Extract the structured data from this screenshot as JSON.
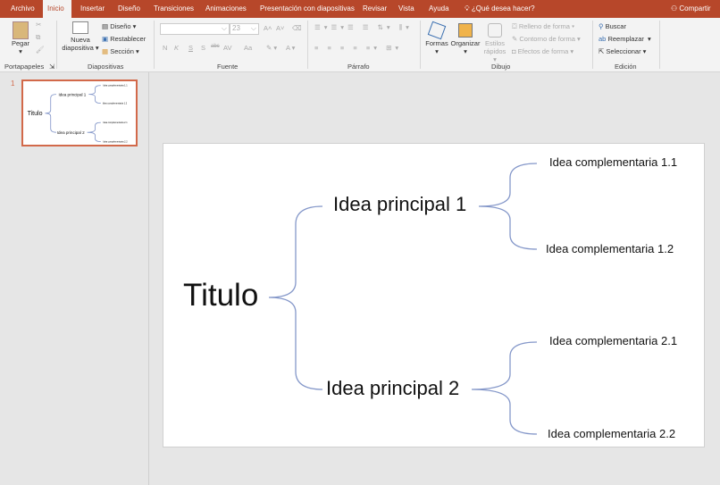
{
  "tabs": [
    "Archivo",
    "Inicio",
    "Insertar",
    "Diseño",
    "Transiciones",
    "Animaciones",
    "Presentación con diapositivas",
    "Revisar",
    "Vista",
    "Ayuda"
  ],
  "tell_me": "¿Qué desea hacer?",
  "share": "Compartir",
  "ribbon": {
    "paste": "Pegar",
    "clipboard": "Portapapeles",
    "new_slide_1": "Nueva",
    "new_slide_2": "diapositiva",
    "layout": "Diseño",
    "reset": "Restablecer",
    "section": "Sección",
    "slides": "Diapositivas",
    "font_size": "23",
    "font_buttons": [
      "N",
      "K",
      "S",
      "S",
      "abc",
      "AV",
      "Aa"
    ],
    "font": "Fuente",
    "paragraph": "Párrafo",
    "shapes": "Formas",
    "arrange": "Organizar",
    "quick_styles_1": "Estilos",
    "quick_styles_2": "rápidos",
    "fill": "Relleno de forma",
    "outline": "Contorno de forma",
    "effects": "Efectos de forma",
    "drawing": "Dibujo",
    "find": "Buscar",
    "replace": "Reemplazar",
    "select": "Seleccionar",
    "editing": "Edición"
  },
  "slide_number": "1",
  "slide": {
    "title": "Titulo",
    "main": [
      "Idea principal 1",
      "Idea principal 2"
    ],
    "sub": [
      "Idea complementaria 1.1",
      "Idea complementaria 1.2",
      "Idea complementaria 2.1",
      "Idea complementaria 2.2"
    ]
  },
  "colors": {
    "accent": "#b7472a",
    "bracket": "#8497c9",
    "thumb_border": "#d2694a"
  }
}
